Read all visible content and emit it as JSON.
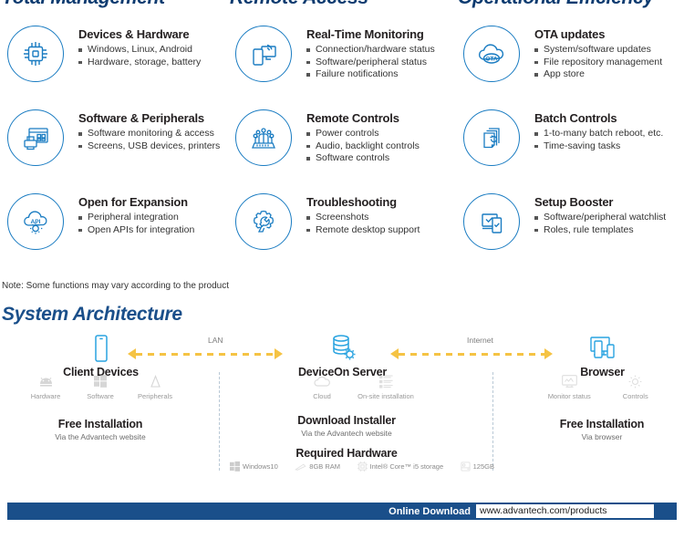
{
  "headings": {
    "col1": "Total Management",
    "col2": "Remote Access",
    "col3": "Operational Efficiency"
  },
  "features": {
    "row1": [
      {
        "icon": "cpu-chip-icon",
        "title": "Devices & Hardware",
        "items": [
          "Windows, Linux, Android",
          "Hardware, storage, battery"
        ]
      },
      {
        "icon": "realtime-monitoring-icon",
        "title": "Real-Time Monitoring",
        "items": [
          "Connection/hardware status",
          "Software/peripheral status",
          "Failure notifications"
        ]
      },
      {
        "icon": "ota-cloud-icon",
        "title": "OTA updates",
        "items": [
          "System/software updates",
          "File repository management",
          "App store"
        ]
      }
    ],
    "row2": [
      {
        "icon": "software-peripherals-icon",
        "title": "Software & Peripherals",
        "items": [
          "Software monitoring & access",
          "Screens, USB devices, printers"
        ]
      },
      {
        "icon": "remote-controls-icon",
        "title": "Remote Controls",
        "items": [
          "Power controls",
          "Audio, backlight controls",
          "Software controls"
        ]
      },
      {
        "icon": "batch-controls-icon",
        "title": "Batch Controls",
        "items": [
          "1-to-many batch reboot, etc.",
          "Time-saving tasks"
        ]
      }
    ],
    "row3": [
      {
        "icon": "api-cloud-gear-icon",
        "title": "Open for Expansion",
        "items": [
          "Peripheral integration",
          "Open APIs for integration"
        ]
      },
      {
        "icon": "troubleshooting-wrench-gear-icon",
        "title": "Troubleshooting",
        "items": [
          "Screenshots",
          "Remote desktop support"
        ]
      },
      {
        "icon": "setup-booster-icon",
        "title": "Setup Booster",
        "items": [
          "Software/peripheral watchlist",
          "Roles, rule templates"
        ]
      }
    ]
  },
  "note": "Note: Some functions may vary according to the product",
  "architecture": {
    "section_title": "System Architecture",
    "nodes": {
      "client": {
        "icon": "mobile-device-icon",
        "label": "Client Devices",
        "subicons": [
          {
            "icon": "android-icon",
            "label": "Hardware"
          },
          {
            "icon": "windows-icon",
            "label": "Software"
          },
          {
            "icon": "peripherals-icon",
            "label": "Peripherals"
          }
        ],
        "install_title": "Free Installation",
        "install_sub": "Via the Advantech website"
      },
      "server": {
        "icon": "database-gear-icon",
        "label": "DeviceOn Server",
        "subicons": [
          {
            "icon": "cloud-icon",
            "label": "Cloud"
          },
          {
            "icon": "onsite-server-icon",
            "label": "On-site installation"
          }
        ],
        "install_title": "Download Installer",
        "install_sub": "Via the Advantech website",
        "required_title": "Required Hardware",
        "required_items": [
          {
            "icon": "windows-icon",
            "label": "Windows10"
          },
          {
            "icon": "memory-ram-icon",
            "label": "8GB RAM"
          },
          {
            "icon": "cpu-icon",
            "label": "Intel® Core™ i5 storage"
          },
          {
            "icon": "hdd-storage-icon",
            "label": "125GB"
          }
        ]
      },
      "browser": {
        "icon": "multi-device-browser-icon",
        "label": "Browser",
        "subicons": [
          {
            "icon": "monitor-status-icon",
            "label": "Monitor status"
          },
          {
            "icon": "controls-gear-icon",
            "label": "Controls"
          }
        ],
        "install_title": "Free Installation",
        "install_sub": "Via browser"
      }
    },
    "connections": [
      {
        "label": "LAN"
      },
      {
        "label": "Internet"
      }
    ]
  },
  "footer": {
    "download_label": "Online Download",
    "url": "www.advantech.com/products"
  },
  "colors": {
    "heading_blue": "#0d3b70",
    "section_blue": "#1a4f8a",
    "icon_blue": "#1a7cc2",
    "arrow_yellow": "#f5c344",
    "footer_bar": "#1a4f8a"
  }
}
